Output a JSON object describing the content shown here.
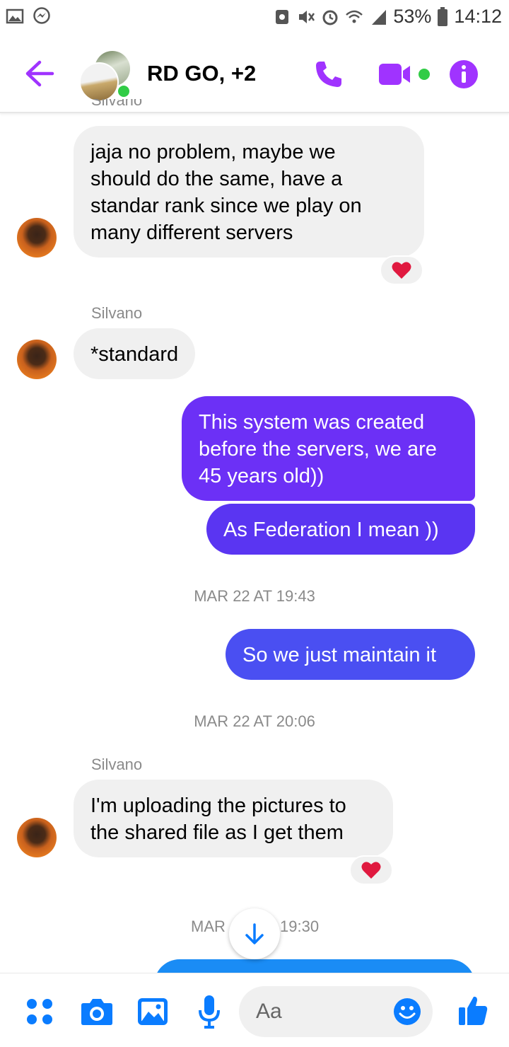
{
  "status_bar": {
    "battery_percent": "53%",
    "time": "14:12"
  },
  "header": {
    "title": "RD GO, +2",
    "accent_color": "#a033ff",
    "online_color": "#31cc46"
  },
  "messages": {
    "truncated_sender": "Silvano",
    "m1": {
      "lines": [
        "jaja no problem, maybe we",
        "should do the same, have a",
        "standar rank since we play on",
        "many different servers"
      ],
      "reaction": "heart"
    },
    "m2": {
      "sender": "Silvano",
      "text": "*standard"
    },
    "m3": {
      "lines": [
        "This system was created",
        "before the servers, we are",
        "45 years old))"
      ],
      "color": "#6c30f6"
    },
    "m4": {
      "text": "As Federation I mean ))",
      "color": "#5a35f2"
    },
    "t1": "MAR 22 AT 19:43",
    "m5": {
      "text": "So we just maintain it",
      "color": "#4a4ff2"
    },
    "t2": "MAR 22 AT 20:06",
    "m6": {
      "sender": "Silvano",
      "lines": [
        "I'm uploading the pictures to",
        "the shared file as I get them"
      ],
      "reaction": "heart"
    },
    "t3_left": "MAR",
    "t3_right": "19:30",
    "next_bubble_color": "#1a8cf5"
  },
  "composer": {
    "placeholder": "Aa",
    "icon_color": "#0a7cff",
    "icons": [
      "menu-dots-icon",
      "camera-icon",
      "gallery-icon",
      "microphone-icon",
      "emoji-icon",
      "thumbs-up-icon"
    ]
  }
}
